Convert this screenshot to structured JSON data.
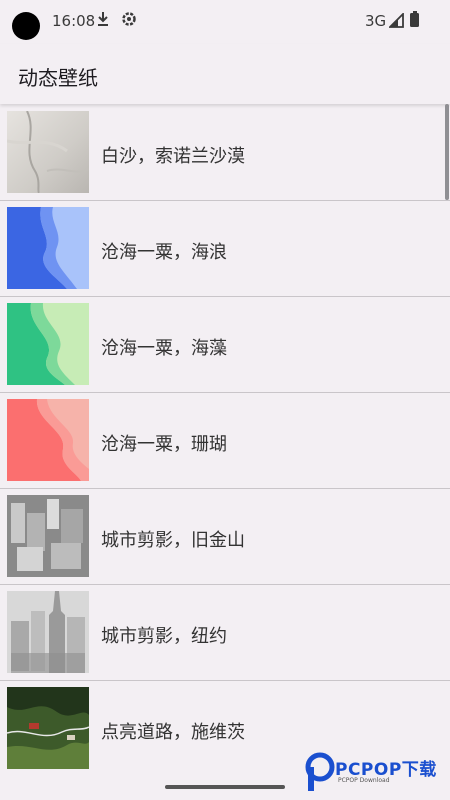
{
  "status": {
    "time": "16:08",
    "network": "3G",
    "icons": [
      "download-icon",
      "gear-icon",
      "signal-icon",
      "battery-icon"
    ]
  },
  "app": {
    "title": "动态壁纸"
  },
  "wallpapers": [
    {
      "label": "白沙，索诺兰沙漠"
    },
    {
      "label": "沧海一粟，海浪"
    },
    {
      "label": "沧海一粟，海藻"
    },
    {
      "label": "沧海一粟，珊瑚"
    },
    {
      "label": "城市剪影，旧金山"
    },
    {
      "label": "城市剪影，纽约"
    },
    {
      "label": "点亮道路，施维茨"
    }
  ],
  "watermark": {
    "brand": "PCPOP下载",
    "sub": "PCPOP Download"
  }
}
